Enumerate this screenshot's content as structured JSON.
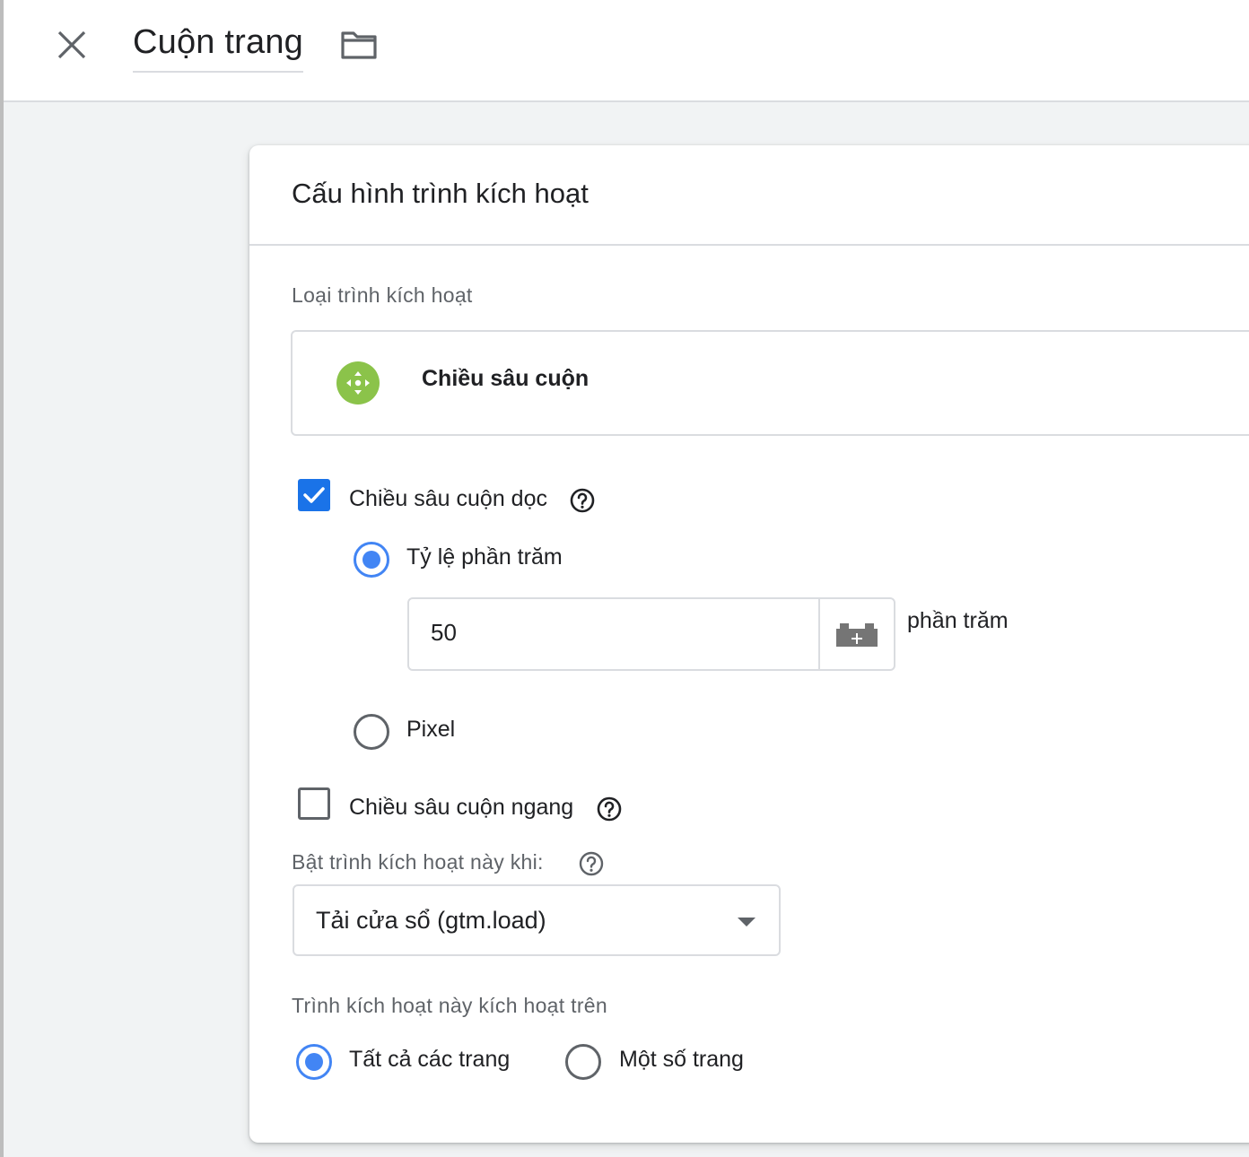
{
  "header": {
    "title": "Cuộn trang",
    "close_icon": "close-icon",
    "folder_icon": "folder-icon"
  },
  "card": {
    "title": "Cấu hình trình kích hoạt",
    "trigger_type_label": "Loại trình kích hoạt",
    "trigger_type": {
      "name": "Chiều sâu cuộn",
      "icon": "scroll-move-icon",
      "icon_color": "#8bc34a"
    },
    "vertical": {
      "label": "Chiều sâu cuộn dọc",
      "checked": true,
      "options": [
        {
          "label": "Tỷ lệ phần trăm",
          "selected": true
        },
        {
          "label": "Pixel",
          "selected": false
        }
      ],
      "percent_value": "50",
      "unit": "phần trăm"
    },
    "horizontal": {
      "label": "Chiều sâu cuộn ngang",
      "checked": false
    },
    "enable_when": {
      "label": "Bật trình kích hoạt này khi:",
      "value": "Tải cửa sổ (gtm.load)"
    },
    "fires_on": {
      "label": "Trình kích hoạt này kích hoạt trên",
      "options": [
        {
          "label": "Tất cả các trang",
          "selected": true
        },
        {
          "label": "Một số trang",
          "selected": false
        }
      ]
    }
  },
  "colors": {
    "accent": "#1a73e8",
    "radio": "#4285f4",
    "muted_text": "#5f6368",
    "border": "#dadce0"
  }
}
